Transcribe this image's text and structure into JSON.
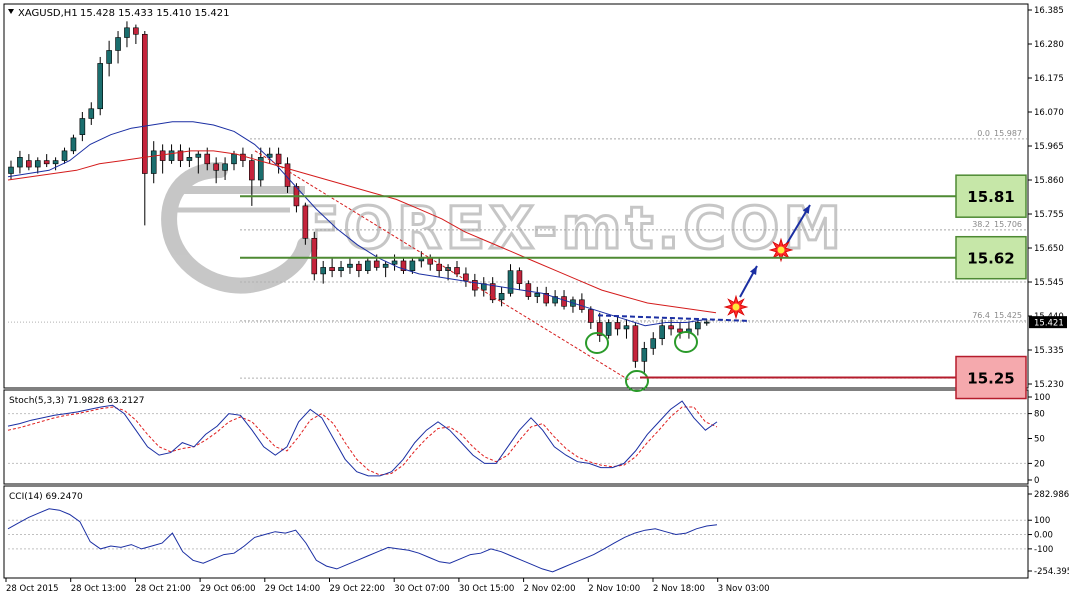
{
  "chart_data": [
    {
      "type": "candlestick",
      "symbol_header": "XAGUSD,H1",
      "ohlc_header": "15.428 15.433 15.410 15.421",
      "current_price": "15.421",
      "price_axis_ticks": [
        "16.385",
        "16.280",
        "16.175",
        "16.070",
        "15.965",
        "15.860",
        "15.755",
        "15.650",
        "15.545",
        "15.440",
        "15.335",
        "15.230"
      ],
      "ylim": [
        15.2,
        16.4
      ],
      "time_axis_ticks": [
        "28 Oct 2015",
        "28 Oct 13:00",
        "28 Oct 21:00",
        "29 Oct 06:00",
        "29 Oct 14:00",
        "29 Oct 22:00",
        "30 Oct 07:00",
        "30 Oct 15:00",
        "2 Nov 02:00",
        "2 Nov 10:00",
        "2 Nov 18:00",
        "3 Nov 03:00"
      ],
      "candles": [
        [
          15.88,
          15.92,
          15.86,
          15.9
        ],
        [
          15.9,
          15.95,
          15.88,
          15.93
        ],
        [
          15.92,
          15.94,
          15.89,
          15.9
        ],
        [
          15.9,
          15.93,
          15.88,
          15.92
        ],
        [
          15.92,
          15.94,
          15.9,
          15.91
        ],
        [
          15.91,
          15.93,
          15.89,
          15.92
        ],
        [
          15.92,
          15.96,
          15.91,
          15.95
        ],
        [
          15.95,
          16.0,
          15.94,
          15.99
        ],
        [
          16.0,
          16.07,
          15.98,
          16.05
        ],
        [
          16.05,
          16.1,
          16.03,
          16.08
        ],
        [
          16.08,
          16.24,
          16.06,
          16.22
        ],
        [
          16.22,
          16.29,
          16.18,
          16.26
        ],
        [
          16.26,
          16.32,
          16.22,
          16.3
        ],
        [
          16.3,
          16.35,
          16.27,
          16.33
        ],
        [
          16.33,
          16.34,
          16.28,
          16.31
        ],
        [
          16.31,
          16.32,
          15.72,
          15.88
        ],
        [
          15.88,
          15.98,
          15.85,
          15.95
        ],
        [
          15.95,
          15.97,
          15.88,
          15.92
        ],
        [
          15.92,
          15.97,
          15.91,
          15.95
        ],
        [
          15.95,
          15.97,
          15.9,
          15.92
        ],
        [
          15.92,
          15.96,
          15.9,
          15.93
        ],
        [
          15.93,
          15.95,
          15.88,
          15.94
        ],
        [
          15.94,
          15.96,
          15.89,
          15.91
        ],
        [
          15.91,
          15.93,
          15.85,
          15.89
        ],
        [
          15.89,
          15.93,
          15.86,
          15.91
        ],
        [
          15.91,
          15.95,
          15.89,
          15.94
        ],
        [
          15.94,
          15.96,
          15.9,
          15.92
        ],
        [
          15.92,
          15.94,
          15.78,
          15.86
        ],
        [
          15.86,
          15.96,
          15.84,
          15.93
        ],
        [
          15.93,
          15.96,
          15.91,
          15.94
        ],
        [
          15.94,
          15.96,
          15.88,
          15.91
        ],
        [
          15.91,
          15.93,
          15.82,
          15.84
        ],
        [
          15.84,
          15.85,
          15.76,
          15.78
        ],
        [
          15.78,
          15.79,
          15.66,
          15.68
        ],
        [
          15.68,
          15.7,
          15.55,
          15.57
        ],
        [
          15.57,
          15.61,
          15.54,
          15.59
        ],
        [
          15.59,
          15.62,
          15.56,
          15.58
        ],
        [
          15.58,
          15.61,
          15.56,
          15.59
        ],
        [
          15.59,
          15.62,
          15.57,
          15.6
        ],
        [
          15.6,
          15.61,
          15.56,
          15.58
        ],
        [
          15.58,
          15.62,
          15.57,
          15.61
        ],
        [
          15.61,
          15.63,
          15.58,
          15.59
        ],
        [
          15.59,
          15.61,
          15.56,
          15.6
        ],
        [
          15.6,
          15.63,
          15.58,
          15.61
        ],
        [
          15.61,
          15.62,
          15.57,
          15.58
        ],
        [
          15.58,
          15.62,
          15.57,
          15.61
        ],
        [
          15.61,
          15.64,
          15.59,
          15.62
        ],
        [
          15.62,
          15.63,
          15.58,
          15.6
        ],
        [
          15.6,
          15.62,
          15.56,
          15.58
        ],
        [
          15.58,
          15.6,
          15.55,
          15.59
        ],
        [
          15.59,
          15.61,
          15.56,
          15.57
        ],
        [
          15.57,
          15.59,
          15.53,
          15.55
        ],
        [
          15.55,
          15.57,
          15.5,
          15.52
        ],
        [
          15.52,
          15.56,
          15.5,
          15.54
        ],
        [
          15.54,
          15.56,
          15.48,
          15.49
        ],
        [
          15.49,
          15.53,
          15.47,
          15.51
        ],
        [
          15.51,
          15.6,
          15.5,
          15.58
        ],
        [
          15.58,
          15.59,
          15.52,
          15.54
        ],
        [
          15.54,
          15.55,
          15.49,
          15.5
        ],
        [
          15.5,
          15.53,
          15.48,
          15.51
        ],
        [
          15.51,
          15.53,
          15.47,
          15.48
        ],
        [
          15.48,
          15.52,
          15.47,
          15.5
        ],
        [
          15.5,
          15.52,
          15.46,
          15.47
        ],
        [
          15.47,
          15.5,
          15.45,
          15.49
        ],
        [
          15.49,
          15.51,
          15.45,
          15.46
        ],
        [
          15.46,
          15.47,
          15.4,
          15.42
        ],
        [
          15.42,
          15.45,
          15.36,
          15.38
        ],
        [
          15.38,
          15.43,
          15.37,
          15.42
        ],
        [
          15.42,
          15.44,
          15.38,
          15.4
        ],
        [
          15.4,
          15.43,
          15.37,
          15.41
        ],
        [
          15.41,
          15.42,
          15.28,
          15.3
        ],
        [
          15.3,
          15.36,
          15.26,
          15.34
        ],
        [
          15.34,
          15.39,
          15.32,
          15.37
        ],
        [
          15.37,
          15.43,
          15.35,
          15.41
        ],
        [
          15.41,
          15.43,
          15.38,
          15.4
        ],
        [
          15.4,
          15.42,
          15.37,
          15.39
        ],
        [
          15.39,
          15.42,
          15.37,
          15.4
        ],
        [
          15.4,
          15.43,
          15.38,
          15.42
        ],
        [
          15.42,
          15.43,
          15.41,
          15.421
        ]
      ],
      "ma_blue": [
        15.87,
        15.88,
        15.89,
        15.92,
        15.97,
        16.0,
        16.02,
        16.03,
        16.04,
        16.04,
        16.03,
        16.01,
        15.97,
        15.91,
        15.84,
        15.77,
        15.71,
        15.66,
        15.62,
        15.59,
        15.57,
        15.56,
        15.55,
        15.54,
        15.53,
        15.52,
        15.51,
        15.49,
        15.47,
        15.45,
        15.43,
        15.41,
        15.42,
        15.42,
        15.43
      ],
      "ma_red": [
        15.86,
        15.87,
        15.88,
        15.89,
        15.91,
        15.92,
        15.93,
        15.94,
        15.95,
        15.95,
        15.94,
        15.92,
        15.9,
        15.88,
        15.86,
        15.84,
        15.82,
        15.8,
        15.77,
        15.74,
        15.7,
        15.67,
        15.64,
        15.61,
        15.58,
        15.55,
        15.52,
        15.5,
        15.48,
        15.47,
        15.46,
        15.45
      ],
      "fibonacci": [
        {
          "label": "0.0",
          "value_label": "15.987",
          "price": 15.987
        },
        {
          "label": "38.2",
          "value_label": "15.706",
          "price": 15.706
        },
        {
          "label": "76.4",
          "value_label": "15.425",
          "price": 15.425
        }
      ],
      "levels": [
        {
          "label": "15.81",
          "price": 15.81,
          "color": "#4e8a33",
          "fill": "#c6e7a8"
        },
        {
          "label": "15.62",
          "price": 15.62,
          "color": "#4e8a33",
          "fill": "#c6e7a8"
        },
        {
          "label": "15.25",
          "price": 15.25,
          "color": "#b51c2c",
          "fill": "#f5a9ad"
        }
      ],
      "watermark": "FOREX-mt.COM"
    },
    {
      "type": "line",
      "indicator_header": "Stoch(5,3,3) 71.9828 63.2127",
      "axis_ticks": [
        "100",
        "80",
        "50",
        "20",
        "0"
      ],
      "ylim": [
        0,
        100
      ],
      "main": [
        65,
        68,
        72,
        75,
        78,
        80,
        82,
        85,
        88,
        90,
        80,
        60,
        40,
        30,
        33,
        45,
        40,
        55,
        65,
        80,
        78,
        60,
        40,
        30,
        40,
        70,
        85,
        75,
        50,
        25,
        10,
        5,
        5,
        10,
        25,
        45,
        60,
        70,
        60,
        45,
        30,
        20,
        20,
        40,
        60,
        75,
        60,
        40,
        30,
        22,
        20,
        15,
        15,
        20,
        35,
        55,
        70,
        85,
        95,
        75,
        60,
        70
      ],
      "signal": [
        60,
        63,
        67,
        71,
        75,
        78,
        80,
        83,
        86,
        88,
        84,
        72,
        55,
        40,
        34,
        38,
        40,
        48,
        58,
        70,
        76,
        70,
        55,
        40,
        35,
        52,
        72,
        80,
        68,
        45,
        25,
        12,
        6,
        8,
        18,
        35,
        50,
        62,
        64,
        55,
        40,
        28,
        22,
        30,
        48,
        64,
        68,
        52,
        38,
        28,
        22,
        18,
        16,
        18,
        28,
        45,
        60,
        76,
        88,
        88,
        70,
        64
      ]
    },
    {
      "type": "line",
      "indicator_header": "CCI(14) 69.2470",
      "axis_ticks": [
        "282.9861",
        "100",
        "0.00",
        "-100",
        "-254.3955"
      ],
      "ylim": [
        -254.3955,
        282.9861
      ],
      "values": [
        40,
        80,
        120,
        150,
        180,
        170,
        140,
        90,
        -50,
        -100,
        -80,
        -90,
        -70,
        -100,
        -80,
        -60,
        10,
        -120,
        -180,
        -200,
        -170,
        -140,
        -130,
        -80,
        -20,
        0,
        20,
        10,
        30,
        -60,
        -180,
        -220,
        -240,
        -210,
        -180,
        -150,
        -120,
        -90,
        -100,
        -110,
        -130,
        -160,
        -190,
        -200,
        -170,
        -140,
        -130,
        -100,
        -120,
        -150,
        -180,
        -210,
        -240,
        -260,
        -230,
        -200,
        -170,
        -140,
        -100,
        -60,
        -20,
        10,
        30,
        40,
        20,
        0,
        10,
        40,
        60,
        69
      ]
    }
  ]
}
